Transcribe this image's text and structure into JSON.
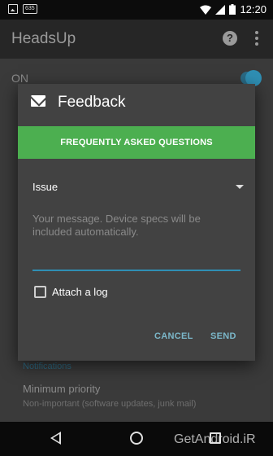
{
  "status_bar": {
    "badge": "635",
    "time": "12:20"
  },
  "app": {
    "title": "HeadsUp",
    "on_label": "ON",
    "section_label": "Notifications",
    "item_title": "Minimum priority",
    "item_subtitle": "Non-important (software updates, junk mail)",
    "accent_color": "#2f8fb4"
  },
  "dialog": {
    "title": "Feedback",
    "faq_label": "FREQUENTLY ASKED QUESTIONS",
    "issue_label": "Issue",
    "message_placeholder": "Your message. Device specs will be included automatically.",
    "attach_label": "Attach a log",
    "attach_checked": false,
    "cancel_label": "CANCEL",
    "send_label": "SEND",
    "faq_color": "#4caf50"
  },
  "watermark": "GetAndroid.iR"
}
